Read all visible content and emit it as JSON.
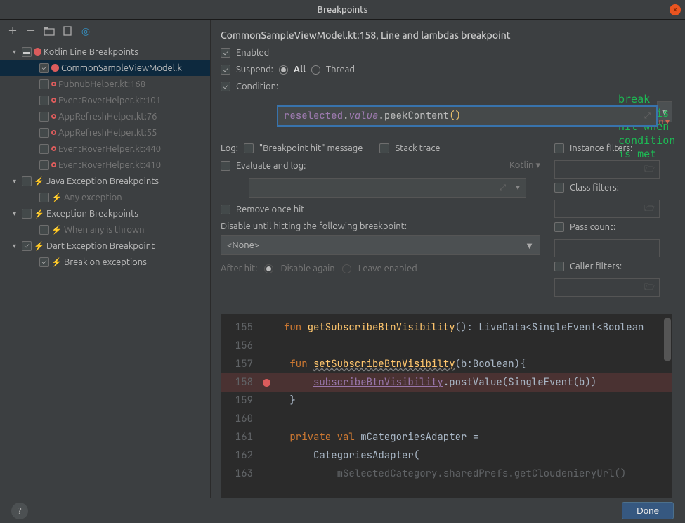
{
  "title": "Breakpoints",
  "tree": {
    "groups": [
      {
        "label": "Kotlin Line Breakpoints",
        "checked": "partial",
        "items": [
          {
            "label": "CommonSampleViewModel.k",
            "checked": true,
            "icon": "full",
            "selected": true
          },
          {
            "label": "PubnubHelper.kt:168",
            "checked": false,
            "icon": "ring"
          },
          {
            "label": "EventRoverHelper.kt:101",
            "checked": false,
            "icon": "ring"
          },
          {
            "label": "AppRefreshHelper.kt:76",
            "checked": false,
            "icon": "ring"
          },
          {
            "label": "AppRefreshHelper.kt:55",
            "checked": false,
            "icon": "ring"
          },
          {
            "label": "EventRoverHelper.kt:440",
            "checked": false,
            "icon": "ring"
          },
          {
            "label": "EventRoverHelper.kt:410",
            "checked": false,
            "icon": "ring"
          }
        ]
      },
      {
        "label": "Java Exception Breakpoints",
        "checked": false,
        "boltColor": "red",
        "items": [
          {
            "label": "Any exception",
            "checked": false
          }
        ]
      },
      {
        "label": "Exception Breakpoints",
        "checked": false,
        "boltColor": "orange",
        "items": [
          {
            "label": "When any is thrown",
            "checked": false
          }
        ]
      },
      {
        "label": "Dart Exception Breakpoint",
        "checked": true,
        "boltColor": "red",
        "items": [
          {
            "label": "Break on exceptions",
            "checked": true
          }
        ]
      }
    ]
  },
  "details": {
    "title": "CommonSampleViewModel.kt:158, Line and lambdas breakpoint",
    "enabled_label": "Enabled",
    "suspend_label": "Suspend:",
    "suspend_all": "All",
    "suspend_thread": "Thread",
    "condition_label": "Condition:",
    "condition_lang": "Kotlin",
    "condition_value": {
      "prop": "reselected",
      "val": "value",
      "meth": "peekContent"
    },
    "log_label": "Log:",
    "log_bphit": "\"Breakpoint hit\" message",
    "log_stack": "Stack trace",
    "eval_label": "Evaluate and log:",
    "eval_lang": "Kotlin",
    "remove_label": "Remove once hit",
    "disable_until": "Disable until hitting the following breakpoint:",
    "disable_select": "<None>",
    "after_hit": "After hit:",
    "after_disable": "Disable again",
    "after_leave": "Leave enabled",
    "filters": {
      "instance": "Instance filters:",
      "class": "Class filters:",
      "pass": "Pass count:",
      "caller": "Caller filters:"
    }
  },
  "annotation": {
    "l1": "break point is hit when",
    "l2": "condition is met"
  },
  "code": {
    "lines": [
      "155",
      "156",
      "157",
      "158",
      "159",
      "160",
      "161",
      "162",
      "163"
    ],
    "l155_fun": "fun",
    "l155_name": "getSubscribeBtnVisibility",
    "l155_ret": "LiveData<SingleEvent<Boolean",
    "l157_fun": "fun",
    "l157_name": "setSubscribeBtnVisibilty",
    "l157_sig": "(b:Boolean){",
    "l158_prop": "subscribeBtnVisibility",
    "l158_rest": ".postValue(SingleEvent(b))",
    "l161_kw": "private val",
    "l161_name": " mCategoriesAdapter =",
    "l162": "CategoriesAdapter(",
    "l163_a": "mSelectedCategory",
    "l163_b": ".sharedPrefs.",
    "l163_c": "getCloudenieryUrl()"
  },
  "footer": {
    "done": "Done"
  }
}
